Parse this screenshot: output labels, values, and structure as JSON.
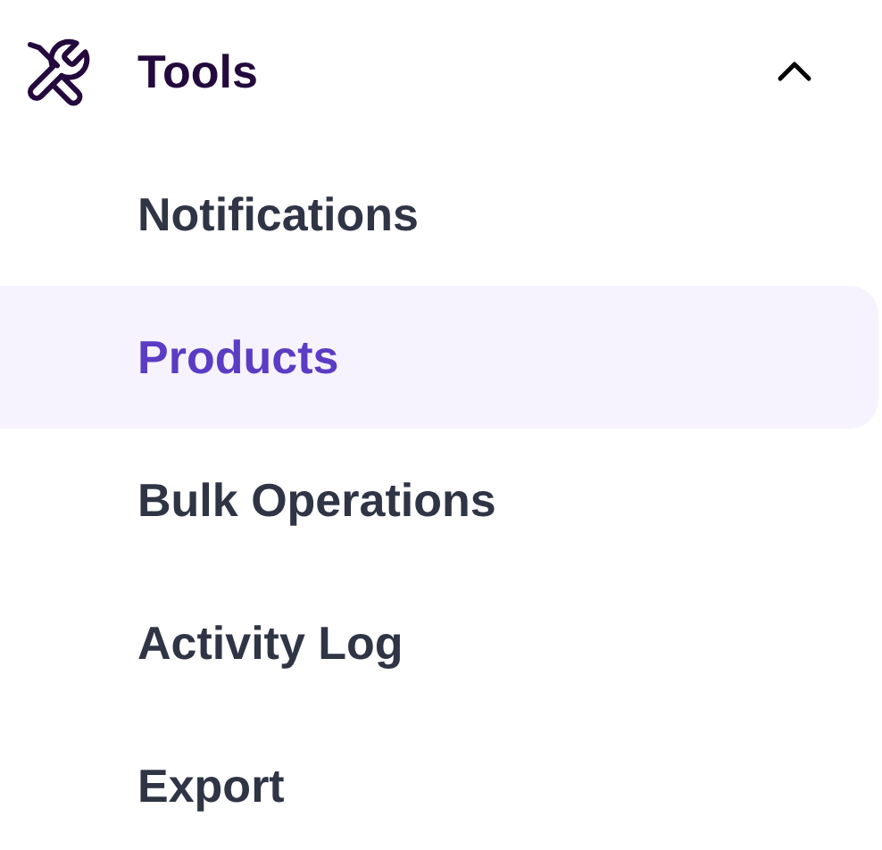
{
  "section": {
    "title": "Tools",
    "expanded": true
  },
  "items": [
    {
      "label": "Notifications",
      "selected": false
    },
    {
      "label": "Products",
      "selected": true
    },
    {
      "label": "Bulk Operations",
      "selected": false
    },
    {
      "label": "Activity Log",
      "selected": false
    },
    {
      "label": "Export",
      "selected": false
    }
  ]
}
